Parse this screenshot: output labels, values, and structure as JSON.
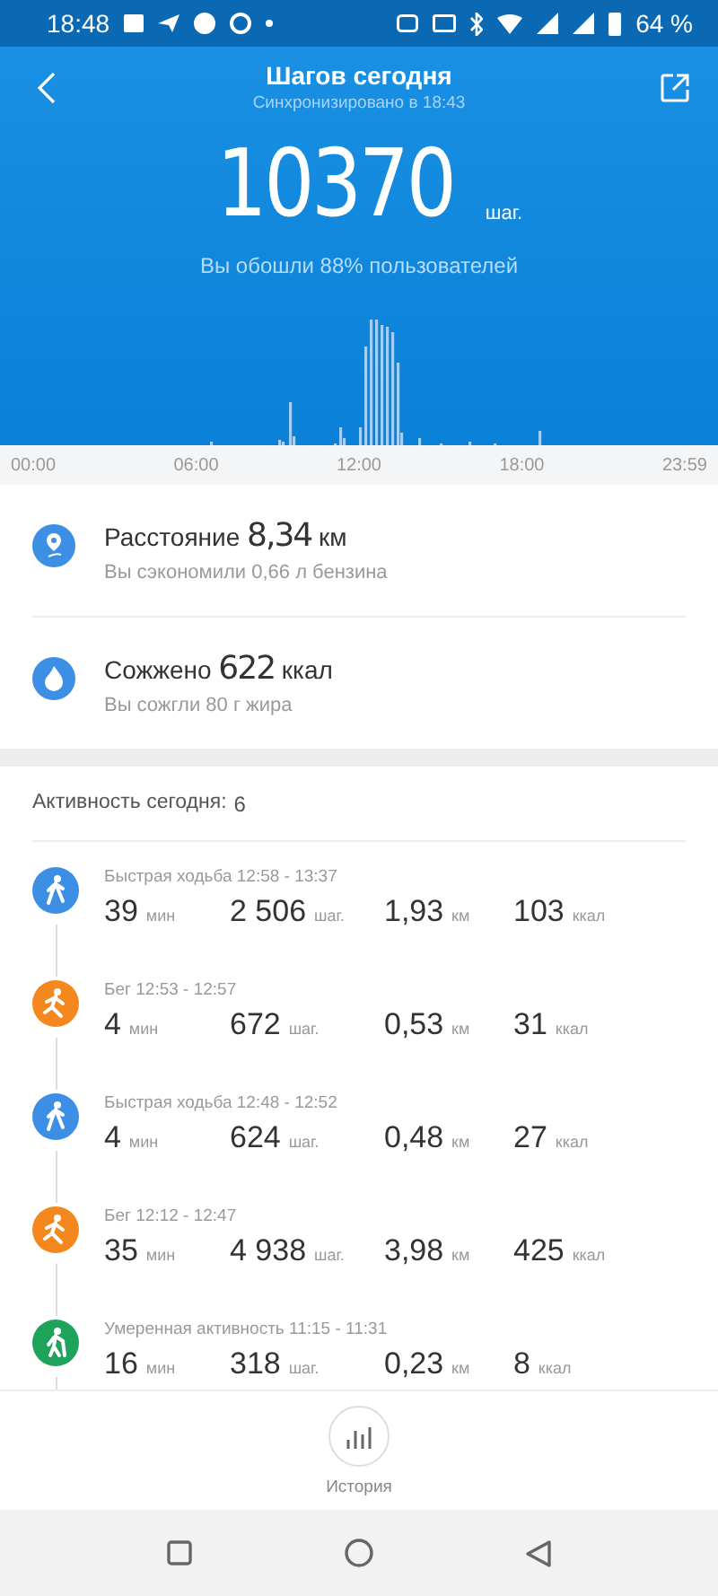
{
  "status_bar": {
    "time": "18:48",
    "battery": "64 %"
  },
  "header": {
    "title": "Шагов сегодня",
    "subtitle": "Синхронизировано в 18:43",
    "steps": "10370",
    "steps_unit": "шаг.",
    "comparison": "Вы обошли 88% пользователей"
  },
  "time_axis": [
    "00:00",
    "06:00",
    "12:00",
    "18:00",
    "23:59"
  ],
  "stats": [
    {
      "kind": "distance",
      "label": "Расстояние",
      "value": "8,34",
      "unit": "км",
      "note": "Вы сэкономили 0,66 л бензина"
    },
    {
      "kind": "calories",
      "label": "Сожжено",
      "value": "622",
      "unit": "ккал",
      "note": "Вы сожгли 80 г жира"
    }
  ],
  "activity": {
    "label": "Активность сегодня:",
    "count": "6",
    "items": [
      {
        "kind": "walk",
        "title": "Быстрая ходьба 12:58 - 13:37",
        "metrics": [
          {
            "value": "39",
            "unit": "мин"
          },
          {
            "value": "2 506",
            "unit": "шаг."
          },
          {
            "value": "1,93",
            "unit": "км"
          },
          {
            "value": "103",
            "unit": "ккал"
          }
        ]
      },
      {
        "kind": "run",
        "title": "Бег 12:53 - 12:57",
        "metrics": [
          {
            "value": "4",
            "unit": "мин"
          },
          {
            "value": "672",
            "unit": "шаг."
          },
          {
            "value": "0,53",
            "unit": "км"
          },
          {
            "value": "31",
            "unit": "ккал"
          }
        ]
      },
      {
        "kind": "walk",
        "title": "Быстрая ходьба 12:48 - 12:52",
        "metrics": [
          {
            "value": "4",
            "unit": "мин"
          },
          {
            "value": "624",
            "unit": "шаг."
          },
          {
            "value": "0,48",
            "unit": "км"
          },
          {
            "value": "27",
            "unit": "ккал"
          }
        ]
      },
      {
        "kind": "run",
        "title": "Бег 12:12 - 12:47",
        "metrics": [
          {
            "value": "35",
            "unit": "мин"
          },
          {
            "value": "4 938",
            "unit": "шаг."
          },
          {
            "value": "3,98",
            "unit": "км"
          },
          {
            "value": "425",
            "unit": "ккал"
          }
        ]
      },
      {
        "kind": "moderate",
        "title": "Умеренная активность 11:15 - 11:31",
        "metrics": [
          {
            "value": "16",
            "unit": "мин"
          },
          {
            "value": "318",
            "unit": "шаг."
          },
          {
            "value": "0,23",
            "unit": "км"
          },
          {
            "value": "8",
            "unit": "ккал"
          }
        ]
      }
    ]
  },
  "bottom_nav": {
    "label": "История"
  }
}
